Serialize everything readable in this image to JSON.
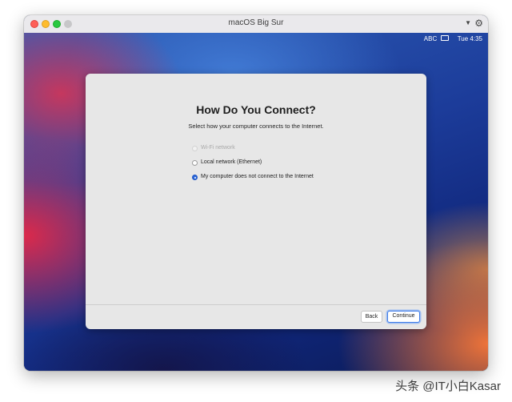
{
  "window": {
    "title": "macOS Big Sur"
  },
  "menubar_status": {
    "input_source": "ABC",
    "clock": "Tue 4:35"
  },
  "setup": {
    "heading": "How Do You Connect?",
    "subheading": "Select how your computer connects to the Internet.",
    "options": [
      {
        "label": "Wi-Fi network",
        "state": "disabled"
      },
      {
        "label": "Local network (Ethernet)",
        "state": "unselected"
      },
      {
        "label": "My computer does not connect to the Internet",
        "state": "selected"
      }
    ],
    "back_label": "Back",
    "continue_label": "Continue"
  },
  "watermark": "头条 @IT小白Kasar",
  "colors": {
    "accent": "#2b66d9",
    "sheet_background": "#e7e7e7"
  }
}
